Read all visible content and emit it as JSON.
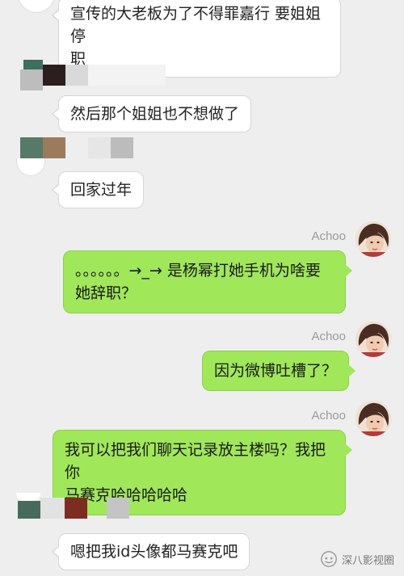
{
  "chat": {
    "messages": [
      {
        "side": "left",
        "text": "宣传的大老板为了不得罪嘉行 要姐姐停\n职"
      },
      {
        "side": "left",
        "text": "然后那个姐姐也不想做了"
      },
      {
        "side": "left",
        "text": "回家过年"
      },
      {
        "side": "right",
        "sender": "Achoo",
        "text": "。。。。。。→_→ 是杨幂打她手机为啥要\n她辞职？"
      },
      {
        "side": "right",
        "sender": "Achoo",
        "text": "因为微博吐槽了？"
      },
      {
        "side": "right",
        "sender": "Achoo",
        "text": "我可以把我们聊天记录放主楼吗？我把你\n马赛克哈哈哈哈哈"
      },
      {
        "side": "left",
        "text": "嗯把我id头像都马赛克吧"
      }
    ]
  },
  "watermark": {
    "text": "深八影视圈",
    "icon": "wechat-channel-icon"
  },
  "colors": {
    "background": "#eeeeee",
    "right_bubble": "#a0e75a",
    "left_bubble": "#ffffff",
    "sender_name": "#9a9a9a"
  }
}
